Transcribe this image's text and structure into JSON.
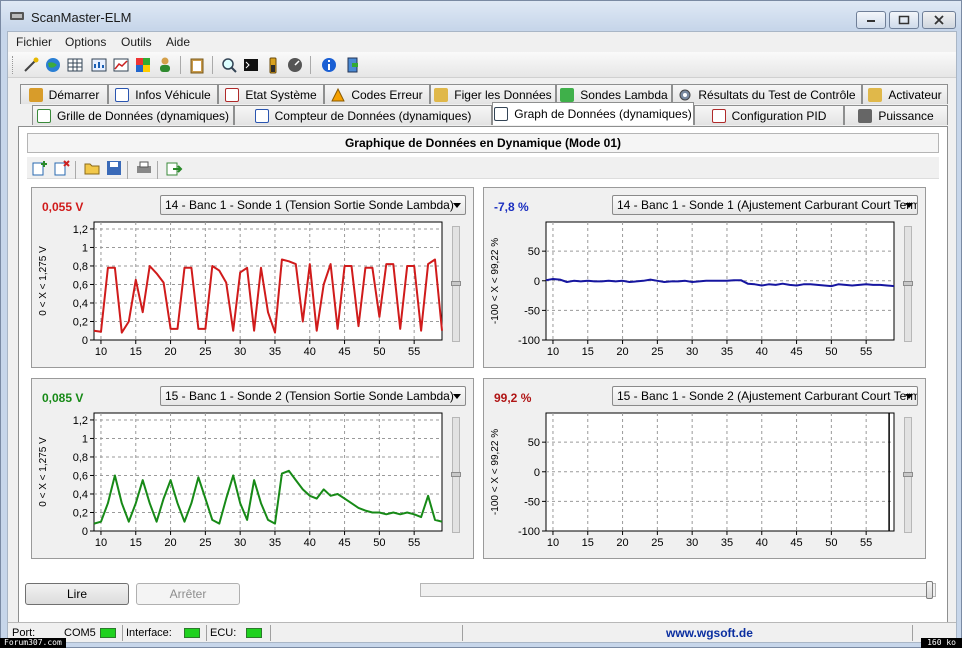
{
  "window": {
    "title": "ScanMaster-ELM"
  },
  "menu": [
    "Fichier",
    "Options",
    "Outils",
    "Aide"
  ],
  "toolbar_icons": [
    "wizard-icon",
    "globe-icon",
    "grid-icon",
    "table-icon",
    "chart-icon",
    "flags-icon",
    "person-icon",
    "clipboard-icon",
    "search-icon",
    "terminal-icon",
    "battery-icon",
    "gauge-icon",
    "info-icon",
    "exit-icon"
  ],
  "tabs_row1": [
    {
      "label": "Démarrer",
      "icon": "start-icon"
    },
    {
      "label": "Infos Véhicule",
      "icon": "info-icon"
    },
    {
      "label": "Etat Système",
      "icon": "checklist-icon"
    },
    {
      "label": "Codes Erreur",
      "icon": "warning-icon"
    },
    {
      "label": "Figer les Données",
      "icon": "freeze-icon"
    },
    {
      "label": "Sondes Lambda",
      "icon": "sensor-icon"
    },
    {
      "label": "Résultats du Test de Contrôle",
      "icon": "gear-icon"
    },
    {
      "label": "Activateur",
      "icon": "activator-icon"
    }
  ],
  "tabs_row2": [
    {
      "label": "Grille de Données (dynamiques)",
      "icon": "grid-icon"
    },
    {
      "label": "Compteur de Données (dynamiques)",
      "icon": "counter-icon"
    },
    {
      "label": "Graph de Données (dynamiques)",
      "icon": "graph-icon",
      "active": true
    },
    {
      "label": "Configuration PID",
      "icon": "config-icon"
    },
    {
      "label": "Puissance",
      "icon": "power-icon"
    }
  ],
  "panel_title": "Graphique de Données en Dynamique (Mode 01)",
  "graph_toolbar_icons": [
    "add-series-icon",
    "remove-series-icon",
    "open-icon",
    "save-icon",
    "print-icon",
    "export-icon"
  ],
  "charts": [
    {
      "id": "c1",
      "value": "0,055 V",
      "value_color": "#d01b1b",
      "select": "14 - Banc 1 - Sonde 1 (Tension Sortie Sonde Lambda)",
      "ylabel": "0  < X <  1,275  V",
      "yticks": [
        "1,2",
        "1",
        "0,8",
        "0,6",
        "0,4",
        "0,2",
        "0"
      ],
      "xticks": [
        "10",
        "15",
        "20",
        "25",
        "30",
        "35",
        "40",
        "45",
        "50",
        "55"
      ]
    },
    {
      "id": "c2",
      "value": "-7,8 %",
      "value_color": "#1a2ec0",
      "select": "14 - Banc 1 - Sonde 1 (Ajustement Carburant Court Terme)",
      "ylabel": "-100  < X <  99,22  %",
      "yticks": [
        "50",
        "0",
        "-50",
        "-100"
      ],
      "xticks": [
        "10",
        "15",
        "20",
        "25",
        "30",
        "35",
        "40",
        "45",
        "50",
        "55"
      ]
    },
    {
      "id": "c3",
      "value": "0,085 V",
      "value_color": "#178a17",
      "select": "15 - Banc 1 - Sonde 2 (Tension Sortie Sonde Lambda)",
      "ylabel": "0  < X <  1,275  V",
      "yticks": [
        "1,2",
        "1",
        "0,8",
        "0,6",
        "0,4",
        "0,2",
        "0"
      ],
      "xticks": [
        "10",
        "15",
        "20",
        "25",
        "30",
        "35",
        "40",
        "45",
        "50",
        "55"
      ]
    },
    {
      "id": "c4",
      "value": "99,2 %",
      "value_color": "#b01515",
      "select": "15 - Banc 1 - Sonde 2 (Ajustement Carburant Court Terme)",
      "ylabel": "-100  < X <  99,22  %",
      "yticks": [
        "50",
        "0",
        "-50",
        "-100"
      ],
      "xticks": [
        "10",
        "15",
        "20",
        "25",
        "30",
        "35",
        "40",
        "45",
        "50",
        "55"
      ]
    }
  ],
  "chart_data": [
    {
      "type": "line",
      "id": "c1",
      "color": "#d01b1b",
      "xlim": [
        9,
        59
      ],
      "ylim": [
        0,
        1.275
      ],
      "x": [
        9,
        10,
        11,
        12,
        13,
        14,
        15,
        16,
        17,
        18,
        19,
        20,
        21,
        22,
        23,
        24,
        25,
        26,
        27,
        28,
        29,
        30,
        31,
        32,
        33,
        34,
        35,
        36,
        37,
        38,
        39,
        40,
        41,
        42,
        43,
        44,
        45,
        46,
        47,
        48,
        49,
        50,
        51,
        52,
        53,
        54,
        55,
        56,
        57,
        58,
        59
      ],
      "y": [
        0.1,
        0.09,
        0.78,
        0.78,
        0.08,
        0.2,
        0.65,
        0.3,
        0.8,
        0.72,
        0.62,
        0.12,
        0.12,
        0.78,
        0.78,
        0.12,
        0.12,
        0.8,
        0.75,
        0.62,
        0.1,
        0.73,
        0.78,
        0.1,
        0.78,
        0.3,
        0.08,
        0.87,
        0.85,
        0.82,
        0.2,
        0.82,
        0.1,
        0.6,
        0.82,
        0.12,
        0.8,
        0.8,
        0.15,
        0.78,
        0.78,
        0.25,
        0.82,
        0.82,
        0.12,
        0.8,
        0.8,
        0.1,
        0.82,
        0.87,
        0.1
      ]
    },
    {
      "type": "line",
      "id": "c2",
      "color": "#1616a0",
      "xlim": [
        9,
        59
      ],
      "ylim": [
        -100,
        99.22
      ],
      "x": [
        9,
        10,
        11,
        12,
        13,
        14,
        15,
        16,
        17,
        18,
        19,
        20,
        21,
        22,
        23,
        24,
        25,
        26,
        27,
        28,
        29,
        30,
        31,
        32,
        33,
        34,
        35,
        36,
        37,
        38,
        39,
        40,
        41,
        42,
        43,
        44,
        45,
        46,
        47,
        48,
        49,
        50,
        51,
        52,
        53,
        54,
        55,
        56,
        57,
        58,
        59
      ],
      "y": [
        1,
        3,
        2,
        -2,
        0,
        -1,
        0,
        -1,
        -1,
        0,
        -1,
        0,
        -2,
        -1,
        0,
        2,
        0,
        -2,
        -1,
        -1,
        0,
        -2,
        -1,
        0,
        0,
        0,
        0,
        1,
        1,
        -5,
        -6,
        -8,
        -6,
        -7,
        -5,
        -7,
        -8,
        -6,
        -6,
        -7,
        -8,
        -9,
        -6,
        -7,
        -8,
        -7,
        -6,
        -7,
        -7,
        -8,
        -9
      ]
    },
    {
      "type": "line",
      "id": "c3",
      "color": "#178a17",
      "xlim": [
        9,
        59
      ],
      "ylim": [
        0,
        1.275
      ],
      "x": [
        9,
        10,
        11,
        12,
        13,
        14,
        15,
        16,
        17,
        18,
        19,
        20,
        21,
        22,
        23,
        24,
        25,
        26,
        27,
        28,
        29,
        30,
        31,
        32,
        33,
        34,
        35,
        36,
        37,
        38,
        39,
        40,
        41,
        42,
        43,
        44,
        45,
        46,
        47,
        48,
        49,
        50,
        51,
        52,
        53,
        54,
        55,
        56,
        57,
        58,
        59
      ],
      "y": [
        0.08,
        0.1,
        0.3,
        0.6,
        0.3,
        0.1,
        0.3,
        0.55,
        0.3,
        0.1,
        0.35,
        0.55,
        0.3,
        0.1,
        0.3,
        0.58,
        0.35,
        0.12,
        0.08,
        0.35,
        0.6,
        0.3,
        0.12,
        0.55,
        0.3,
        0.12,
        0.08,
        0.62,
        0.65,
        0.55,
        0.45,
        0.38,
        0.35,
        0.45,
        0.38,
        0.4,
        0.35,
        0.3,
        0.25,
        0.22,
        0.2,
        0.2,
        0.18,
        0.2,
        0.18,
        0.2,
        0.18,
        0.15,
        0.38,
        0.12,
        0.1
      ]
    },
    {
      "type": "line",
      "id": "c4",
      "color": "#000000",
      "xlim": [
        9,
        59
      ],
      "ylim": [
        -100,
        99.22
      ],
      "x": [
        58.3,
        58.3
      ],
      "y": [
        -100,
        99.22
      ]
    }
  ],
  "buttons": {
    "read": "Lire",
    "stop": "Arrêter"
  },
  "status": {
    "port_label": "Port:",
    "port_value": "COM5",
    "interface_label": "Interface:",
    "ecu_label": "ECU:",
    "website": "www.wgsoft.de"
  },
  "overlays": {
    "left": "Forum307.com",
    "right": "160 ko"
  }
}
